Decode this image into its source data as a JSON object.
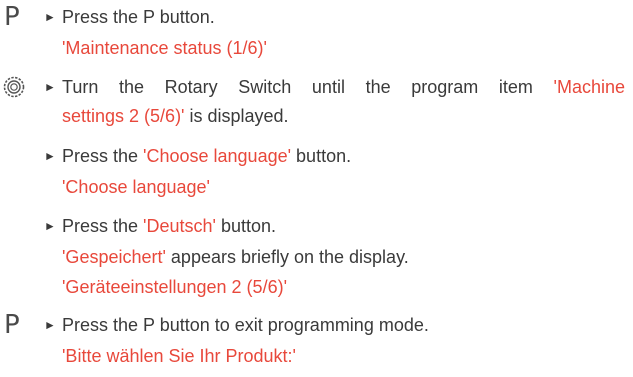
{
  "steps": [
    {
      "icon": "P",
      "action": "Press the P button."
    },
    {
      "display": "'Maintenance status (1/6)'"
    },
    {
      "icon": "rotary",
      "action_pre": "Turn the Rotary Switch until the program item ",
      "action_red": "'Machine",
      "action_post": ""
    },
    {
      "red": "settings 2 (5/6)'",
      "post": " is displayed."
    },
    {
      "pre": "Press the ",
      "red": "'Choose language'",
      "post": " button."
    },
    {
      "display": "'Choose language'"
    },
    {
      "pre": "Press the ",
      "red": "'Deutsch'",
      "post": " button."
    },
    {
      "red": "'Gespeichert'",
      "post": " appears briefly on the display."
    },
    {
      "display": "'Geräteeinstellungen 2 (5/6)'"
    },
    {
      "icon": "P",
      "action": "Press the P button to exit programming mode."
    },
    {
      "display": "'Bitte wählen Sie Ihr Produkt:'"
    }
  ],
  "bullet_glyph": "►",
  "colors": {
    "text": "#3a3a3a",
    "display_red": "#e8483b"
  }
}
